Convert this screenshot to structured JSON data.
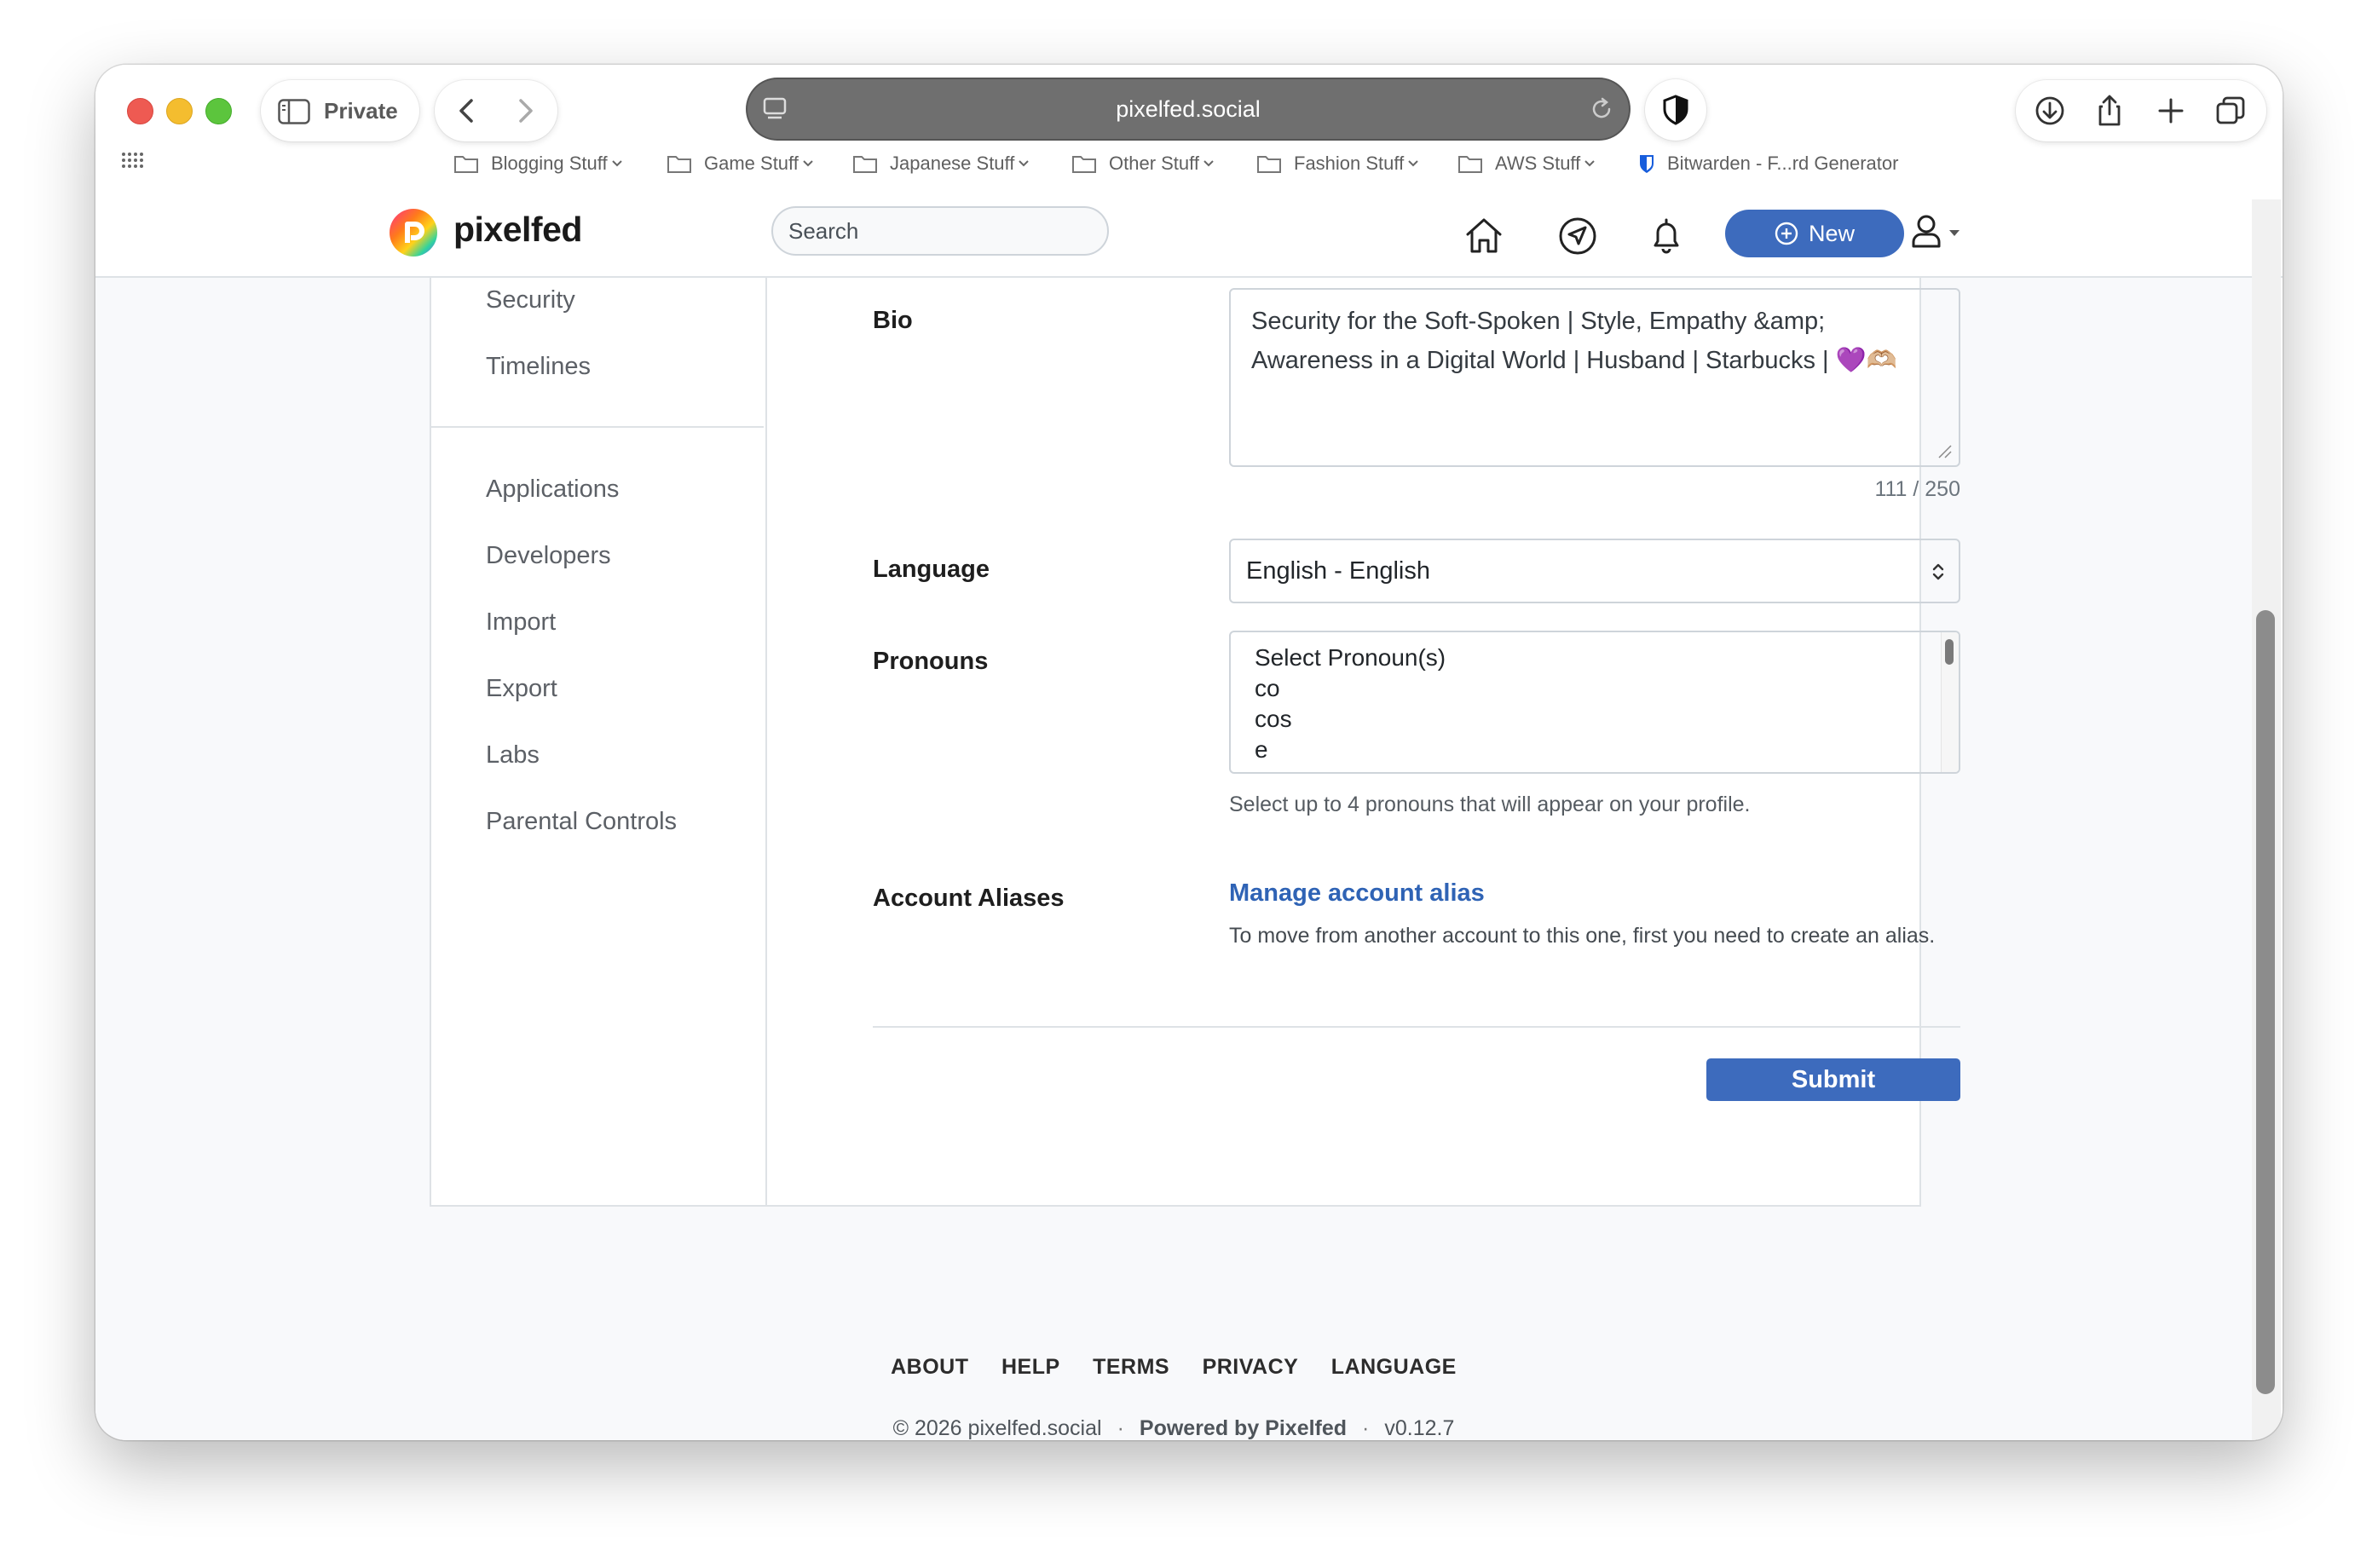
{
  "browser": {
    "private_label": "Private",
    "url": "pixelfed.social",
    "bookmarks": [
      {
        "label": "Blogging Stuff"
      },
      {
        "label": "Game Stuff"
      },
      {
        "label": "Japanese Stuff"
      },
      {
        "label": "Other Stuff"
      },
      {
        "label": "Fashion Stuff"
      },
      {
        "label": "AWS Stuff"
      },
      {
        "label": "Bitwarden - F...rd Generator"
      }
    ]
  },
  "header": {
    "brand": "pixelfed",
    "search_placeholder": "Search",
    "new_label": "New",
    "accent_color": "#3d6bbd"
  },
  "sidebar": {
    "items": [
      {
        "label": "Security"
      },
      {
        "label": "Timelines"
      },
      {
        "label": "Applications"
      },
      {
        "label": "Developers"
      },
      {
        "label": "Import"
      },
      {
        "label": "Export"
      },
      {
        "label": "Labs"
      },
      {
        "label": "Parental Controls"
      }
    ]
  },
  "form": {
    "bio_label": "Bio",
    "bio_value": "Security for the Soft-Spoken | Style, Empathy &amp; Awareness in a Digital World | Husband | Starbucks | 💜🫶🏼",
    "bio_counter": "111 / 250",
    "language_label": "Language",
    "language_value": "English - English",
    "pronouns_label": "Pronouns",
    "pronoun_options": [
      "Select Pronoun(s)",
      "co",
      "cos",
      "e"
    ],
    "pronouns_help": "Select up to 4 pronouns that will appear on your profile.",
    "aliases_label": "Account Aliases",
    "aliases_link": "Manage account alias",
    "aliases_desc": "To move from another account to this one, first you need to create an alias.",
    "submit_label": "Submit"
  },
  "footer": {
    "links": [
      "ABOUT",
      "HELP",
      "TERMS",
      "PRIVACY",
      "LANGUAGE"
    ],
    "copyright": "© 2026 pixelfed.social",
    "powered": "Powered by Pixelfed",
    "version": "v0.12.7"
  }
}
